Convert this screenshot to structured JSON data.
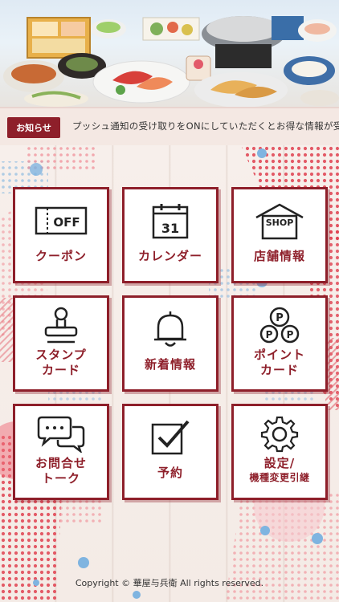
{
  "notice": {
    "badge": "お知らせ",
    "message": "プッシュ通知の受け取りをONにしていただくとお得な情報が受"
  },
  "menu": [
    {
      "key": "coupon",
      "icon_text": "OFF",
      "label": "クーポン",
      "icon": "coupon-ticket-icon"
    },
    {
      "key": "calendar",
      "icon_text": "31",
      "label": "カレンダー",
      "icon": "calendar-icon"
    },
    {
      "key": "shop",
      "icon_text": "SHOP",
      "label": "店舗情報",
      "icon": "shop-icon"
    },
    {
      "key": "stamp",
      "label_line1": "スタンプ",
      "label_line2": "カード",
      "icon": "stamp-icon"
    },
    {
      "key": "news",
      "label": "新着情報",
      "icon": "bell-icon"
    },
    {
      "key": "point",
      "icon_text": "P",
      "label_line1": "ポイント",
      "label_line2": "カード",
      "icon": "point-coins-icon"
    },
    {
      "key": "contact",
      "label_line1": "お問合せ",
      "label_line2": "トーク",
      "icon": "chat-bubbles-icon"
    },
    {
      "key": "reserve",
      "label": "予約",
      "icon": "checkbox-icon"
    },
    {
      "key": "settings",
      "label_line1": "設定/",
      "label_line2": "機種変更引継",
      "icon": "gear-icon"
    }
  ],
  "footer": {
    "copyright": "Copyright © 華屋与兵衛 All rights reserved."
  },
  "colors": {
    "brand": "#8e1f2a",
    "accent_dots": "#e0404f",
    "blue_dots": "#7fb4e0"
  }
}
